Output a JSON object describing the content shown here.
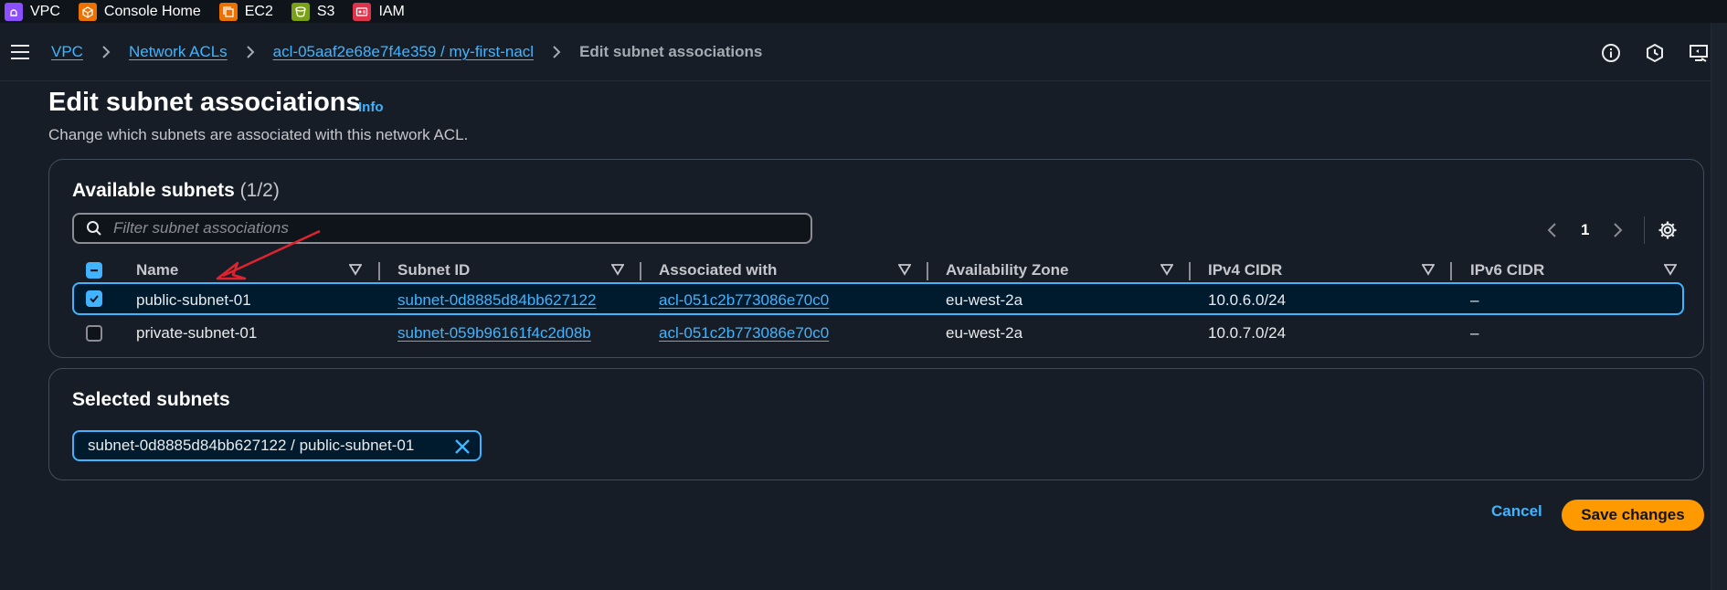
{
  "favorites": [
    {
      "label": "VPC",
      "color": "#8c4fff",
      "icon": "vpc-icon"
    },
    {
      "label": "Console Home",
      "color": "#ed7100",
      "icon": "console-home-icon"
    },
    {
      "label": "EC2",
      "color": "#ed7100",
      "icon": "ec2-icon"
    },
    {
      "label": "S3",
      "color": "#7aa116",
      "icon": "s3-icon"
    },
    {
      "label": "IAM",
      "color": "#dd344c",
      "icon": "iam-icon"
    }
  ],
  "breadcrumb": {
    "items": [
      "VPC",
      "Network ACLs",
      "acl-05aaf2e68e7f4e359 / my-first-nacl"
    ],
    "current": "Edit subnet associations"
  },
  "header": {
    "title": "Edit subnet associations",
    "info": "Info",
    "description": "Change which subnets are associated with this network ACL."
  },
  "available": {
    "title": "Available subnets",
    "count": "(1/2)",
    "filter_placeholder": "Filter subnet associations",
    "page": "1",
    "columns": [
      "Name",
      "Subnet ID",
      "Associated with",
      "Availability Zone",
      "IPv4 CIDR",
      "IPv6 CIDR"
    ],
    "rows": [
      {
        "selected": true,
        "name": "public-subnet-01",
        "subnet_id": "subnet-0d8885d84bb627122",
        "associated": "acl-051c2b773086e70c0",
        "az": "eu-west-2a",
        "ipv4": "10.0.6.0/24",
        "ipv6": "–"
      },
      {
        "selected": false,
        "name": "private-subnet-01",
        "subnet_id": "subnet-059b96161f4c2d08b",
        "associated": "acl-051c2b773086e70c0",
        "az": "eu-west-2a",
        "ipv4": "10.0.7.0/24",
        "ipv6": "–"
      }
    ]
  },
  "selected": {
    "title": "Selected subnets",
    "token": "subnet-0d8885d84bb627122 / public-subnet-01"
  },
  "actions": {
    "cancel": "Cancel",
    "save": "Save changes"
  },
  "colors": {
    "accent": "#42b4ff",
    "primary_button": "#ff9900",
    "background": "#161d26",
    "annotation": "#e0232f"
  }
}
